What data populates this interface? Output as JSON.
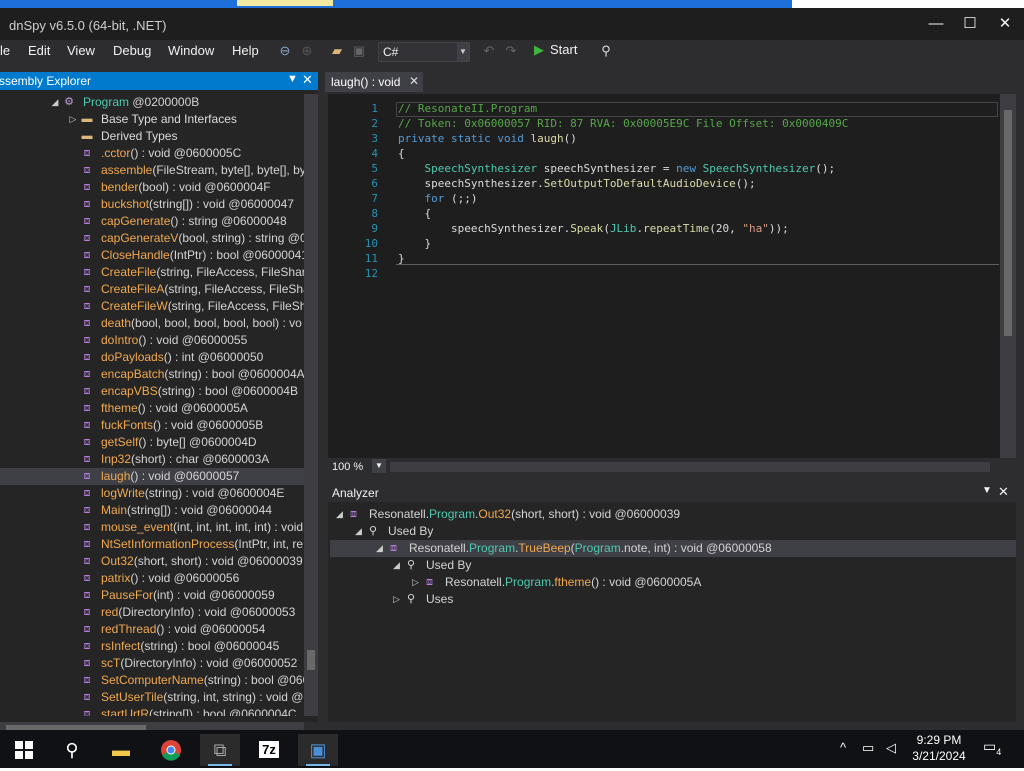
{
  "window": {
    "title": "dnSpy v6.5.0 (64-bit, .NET)",
    "minimize": "—",
    "maximize": "☐",
    "close": "✕"
  },
  "menu": [
    "File",
    "Edit",
    "View",
    "Debug",
    "Window",
    "Help"
  ],
  "menu_visible": [
    "le",
    "Edit",
    "View",
    "Debug",
    "Window",
    "Help"
  ],
  "toolbar": {
    "language": "C#",
    "start_label": "Start"
  },
  "explorer": {
    "title": "Assembly Explorer",
    "title_visible": "ssembly Explorer",
    "items": [
      {
        "name": "Program",
        "sig": " @0200000B",
        "kind": "class",
        "indent": 1,
        "expander": "◢"
      },
      {
        "name": "Base Type and Interfaces",
        "sig": "",
        "kind": "folder",
        "indent": 2,
        "expander": "▷"
      },
      {
        "name": "Derived Types",
        "sig": "",
        "kind": "folder",
        "indent": 2,
        "expander": ""
      },
      {
        "name": ".cctor",
        "sig": "() : void @0600005C",
        "kind": "method",
        "indent": 2
      },
      {
        "name": "assemble",
        "sig": "(FileStream, byte[], byte[], by",
        "kind": "method",
        "indent": 2
      },
      {
        "name": "bender",
        "sig": "(bool) : void @0600004F",
        "kind": "method",
        "indent": 2
      },
      {
        "name": "buckshot",
        "sig": "(string[]) : void @06000047",
        "kind": "method",
        "indent": 2
      },
      {
        "name": "capGenerate",
        "sig": "() : string @06000048",
        "kind": "method",
        "indent": 2
      },
      {
        "name": "capGenerateV",
        "sig": "(bool, string) : string @0",
        "kind": "method",
        "indent": 2
      },
      {
        "name": "CloseHandle",
        "sig": "(IntPtr) : bool @06000041",
        "kind": "method",
        "indent": 2
      },
      {
        "name": "CreateFile",
        "sig": "(string, FileAccess, FileShare,",
        "kind": "method",
        "indent": 2
      },
      {
        "name": "CreateFileA",
        "sig": "(string, FileAccess, FileShar",
        "kind": "method",
        "indent": 2
      },
      {
        "name": "CreateFileW",
        "sig": "(string, FileAccess, FileSha",
        "kind": "method",
        "indent": 2
      },
      {
        "name": "death",
        "sig": "(bool, bool, bool, bool, bool) : vo",
        "kind": "method",
        "indent": 2
      },
      {
        "name": "doIntro",
        "sig": "() : void @06000055",
        "kind": "method",
        "indent": 2
      },
      {
        "name": "doPayloads",
        "sig": "() : int @06000050",
        "kind": "method",
        "indent": 2
      },
      {
        "name": "encapBatch",
        "sig": "(string) : bool @0600004A",
        "kind": "method",
        "indent": 2
      },
      {
        "name": "encapVBS",
        "sig": "(string) : bool @0600004B",
        "kind": "method",
        "indent": 2
      },
      {
        "name": "ftheme",
        "sig": "() : void @0600005A",
        "kind": "method",
        "indent": 2
      },
      {
        "name": "fuckFonts",
        "sig": "() : void @0600005B",
        "kind": "method",
        "indent": 2
      },
      {
        "name": "getSelf",
        "sig": "() : byte[] @0600004D",
        "kind": "method",
        "indent": 2
      },
      {
        "name": "Inp32",
        "sig": "(short) : char @0600003A",
        "kind": "method",
        "indent": 2
      },
      {
        "name": "laugh",
        "sig": "() : void @06000057",
        "kind": "method",
        "indent": 2,
        "selected": true
      },
      {
        "name": "logWrite",
        "sig": "(string) : void @0600004E",
        "kind": "method",
        "indent": 2
      },
      {
        "name": "Main",
        "sig": "(string[]) : void @06000044",
        "kind": "method",
        "indent": 2
      },
      {
        "name": "mouse_event",
        "sig": "(int, int, int, int, int) : void",
        "kind": "method",
        "indent": 2
      },
      {
        "name": "NtSetInformationProcess",
        "sig": "(IntPtr, int, re",
        "kind": "method",
        "indent": 2
      },
      {
        "name": "Out32",
        "sig": "(short, short) : void @06000039",
        "kind": "method",
        "indent": 2
      },
      {
        "name": "patrix",
        "sig": "() : void @06000056",
        "kind": "method",
        "indent": 2
      },
      {
        "name": "PauseFor",
        "sig": "(int) : void @06000059",
        "kind": "method",
        "indent": 2
      },
      {
        "name": "red",
        "sig": "(DirectoryInfo) : void @06000053",
        "kind": "method",
        "indent": 2
      },
      {
        "name": "redThread",
        "sig": "() : void @06000054",
        "kind": "method",
        "indent": 2
      },
      {
        "name": "rsInfect",
        "sig": "(string) : bool @06000045",
        "kind": "method",
        "indent": 2
      },
      {
        "name": "scT",
        "sig": "(DirectoryInfo) : void @06000052",
        "kind": "method",
        "indent": 2
      },
      {
        "name": "SetComputerName",
        "sig": "(string) : bool @060",
        "kind": "method",
        "indent": 2
      },
      {
        "name": "SetUserTile",
        "sig": "(string, int, string) : void @0",
        "kind": "method",
        "indent": 2
      },
      {
        "name": "startUrtR",
        "sig": "(string[]) : bool @0600004C",
        "kind": "method",
        "indent": 2
      }
    ]
  },
  "editor": {
    "tab_title": "laugh() : void",
    "line_numbers": [
      "1",
      "2",
      "3",
      "4",
      "5",
      "6",
      "7",
      "8",
      "9",
      "10",
      "11",
      "12"
    ],
    "lines": [
      [
        {
          "t": "// ResonateII.Program",
          "c": "c-com"
        }
      ],
      [
        {
          "t": "// Token: 0x06000057 RID: 87 RVA: 0x00005E9C File Offset: 0x0000409C",
          "c": "c-com"
        }
      ],
      [
        {
          "t": "private static void ",
          "c": "c-kw"
        },
        {
          "t": "laugh",
          "c": "c-meth"
        },
        {
          "t": "()",
          "c": ""
        }
      ],
      [
        {
          "t": "{",
          "c": ""
        }
      ],
      [
        {
          "t": "    ",
          "c": ""
        },
        {
          "t": "SpeechSynthesizer",
          "c": "c-type"
        },
        {
          "t": " speechSynthesizer = ",
          "c": ""
        },
        {
          "t": "new ",
          "c": "c-kw"
        },
        {
          "t": "SpeechSynthesizer",
          "c": "c-type"
        },
        {
          "t": "();",
          "c": ""
        }
      ],
      [
        {
          "t": "    speechSynthesizer.",
          "c": ""
        },
        {
          "t": "SetOutputToDefaultAudioDevice",
          "c": "c-meth"
        },
        {
          "t": "();",
          "c": ""
        }
      ],
      [
        {
          "t": "    ",
          "c": ""
        },
        {
          "t": "for",
          "c": "c-kw"
        },
        {
          "t": " (;;)",
          "c": ""
        }
      ],
      [
        {
          "t": "    {",
          "c": ""
        }
      ],
      [
        {
          "t": "        speechSynthesizer.",
          "c": ""
        },
        {
          "t": "Speak",
          "c": "c-meth"
        },
        {
          "t": "(",
          "c": ""
        },
        {
          "t": "JLib",
          "c": "c-lib"
        },
        {
          "t": ".",
          "c": ""
        },
        {
          "t": "repeatTime",
          "c": "c-meth"
        },
        {
          "t": "(20, ",
          "c": ""
        },
        {
          "t": "\"ha\"",
          "c": "c-str"
        },
        {
          "t": "));",
          "c": ""
        }
      ],
      [
        {
          "t": "    }",
          "c": ""
        }
      ],
      [
        {
          "t": "}",
          "c": ""
        }
      ],
      [
        {
          "t": "",
          "c": ""
        }
      ]
    ],
    "zoom": "100 %"
  },
  "analyzer": {
    "title": "Analyzer",
    "rows": [
      {
        "indent": 0,
        "exp": "◢",
        "icon": "method",
        "parts": [
          [
            "Resonatell.",
            "ns"
          ],
          [
            "Program",
            "type"
          ],
          [
            ".",
            ""
          ],
          [
            "Out32",
            "mname"
          ],
          [
            "(short, short) : void @06000039",
            ""
          ]
        ]
      },
      {
        "indent": 1,
        "exp": "◢",
        "icon": "search",
        "parts": [
          [
            "Used By",
            ""
          ]
        ]
      },
      {
        "indent": 2,
        "exp": "◢",
        "icon": "method",
        "selected": true,
        "parts": [
          [
            "Resonatell.",
            "ns"
          ],
          [
            "Program",
            "type"
          ],
          [
            ".",
            ""
          ],
          [
            "TrueBeep",
            "mname"
          ],
          [
            "(",
            ""
          ],
          [
            "Program",
            "type"
          ],
          [
            ".note, int) : void @06000058",
            ""
          ]
        ]
      },
      {
        "indent": 3,
        "exp": "◢",
        "icon": "search",
        "parts": [
          [
            "Used By",
            ""
          ]
        ]
      },
      {
        "indent": 4,
        "exp": "▷",
        "icon": "method",
        "parts": [
          [
            "Resonatell.",
            "ns"
          ],
          [
            "Program",
            "type"
          ],
          [
            ".",
            ""
          ],
          [
            "ftheme",
            "mname"
          ],
          [
            "() : void @0600005A",
            ""
          ]
        ]
      },
      {
        "indent": 3,
        "exp": "▷",
        "icon": "search",
        "parts": [
          [
            "Uses",
            ""
          ]
        ]
      }
    ]
  },
  "taskbar": {
    "time": "9:29 PM",
    "date": "3/21/2024",
    "notifications": "4"
  },
  "colors": {
    "accent": "#007acc",
    "method": "#f1a94f",
    "type": "#4ec9b0",
    "keyword": "#569cd6",
    "comment": "#57a64a"
  }
}
